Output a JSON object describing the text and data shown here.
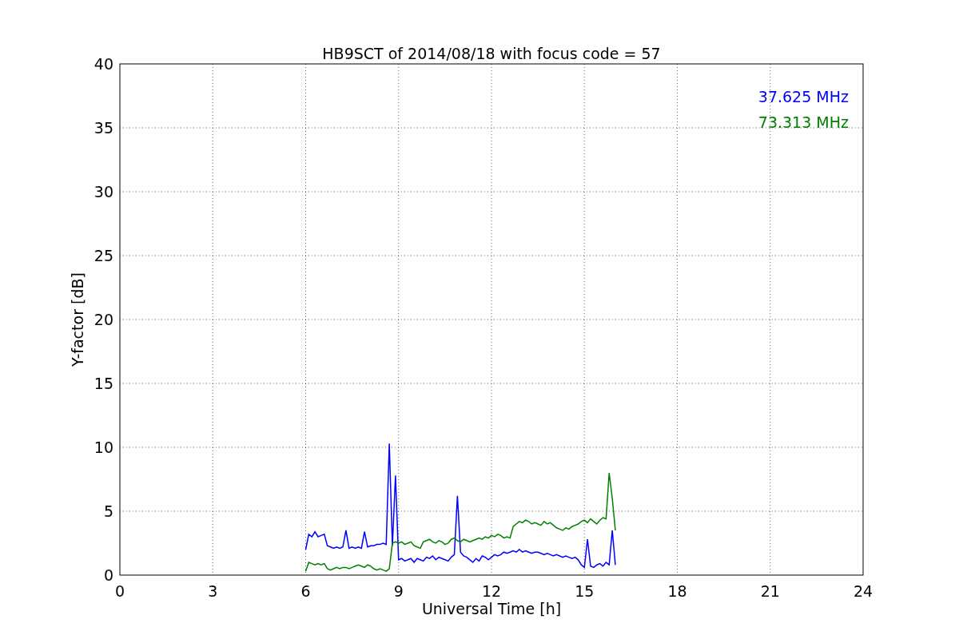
{
  "figure": {
    "chart_data": {
      "type": "line",
      "title": "HB9SCT of 2014/08/18 with focus code = 57",
      "xlabel": "Universal Time [h]",
      "ylabel": "Y-factor [dB]",
      "xlim": [
        0,
        24
      ],
      "ylim": [
        0,
        40
      ],
      "xticks": [
        0,
        3,
        6,
        9,
        12,
        15,
        18,
        21,
        24
      ],
      "yticks": [
        0,
        5,
        10,
        15,
        20,
        25,
        30,
        35,
        40
      ],
      "grid": true,
      "x": [
        6,
        6.1,
        6.2,
        6.3,
        6.4,
        6.5,
        6.6,
        6.7,
        6.8,
        6.9,
        7,
        7.1,
        7.2,
        7.3,
        7.4,
        7.5,
        7.6,
        7.7,
        7.8,
        7.9,
        8,
        8.1,
        8.2,
        8.3,
        8.4,
        8.5,
        8.6,
        8.7,
        8.8,
        8.9,
        9,
        9.1,
        9.2,
        9.3,
        9.4,
        9.5,
        9.6,
        9.7,
        9.8,
        9.9,
        10,
        10.1,
        10.2,
        10.3,
        10.4,
        10.5,
        10.6,
        10.7,
        10.8,
        10.9,
        11,
        11.1,
        11.2,
        11.3,
        11.4,
        11.5,
        11.6,
        11.7,
        11.8,
        11.9,
        12,
        12.1,
        12.2,
        12.3,
        12.4,
        12.5,
        12.6,
        12.7,
        12.8,
        12.9,
        13,
        13.1,
        13.2,
        13.3,
        13.4,
        13.5,
        13.6,
        13.7,
        13.8,
        13.9,
        14,
        14.1,
        14.2,
        14.3,
        14.4,
        14.5,
        14.6,
        14.7,
        14.8,
        14.9,
        15,
        15.1,
        15.2,
        15.3,
        15.4,
        15.5,
        15.6,
        15.7,
        15.8,
        15.9,
        16
      ],
      "series": [
        {
          "name": "37.625 MHz",
          "color": "#0000ff",
          "values": [
            2.0,
            3.2,
            3.0,
            3.4,
            3.0,
            3.1,
            3.2,
            2.3,
            2.2,
            2.1,
            2.2,
            2.1,
            2.2,
            3.5,
            2.1,
            2.2,
            2.1,
            2.2,
            2.1,
            3.4,
            2.2,
            2.3,
            2.3,
            2.4,
            2.4,
            2.5,
            2.4,
            10.3,
            2.3,
            7.8,
            1.2,
            1.3,
            1.1,
            1.2,
            1.3,
            1.0,
            1.3,
            1.2,
            1.1,
            1.4,
            1.3,
            1.5,
            1.2,
            1.4,
            1.3,
            1.2,
            1.1,
            1.4,
            1.6,
            6.2,
            1.8,
            1.5,
            1.4,
            1.2,
            1.0,
            1.3,
            1.1,
            1.5,
            1.4,
            1.2,
            1.4,
            1.6,
            1.5,
            1.6,
            1.8,
            1.7,
            1.8,
            1.9,
            1.8,
            2.0,
            1.8,
            1.9,
            1.8,
            1.7,
            1.8,
            1.8,
            1.7,
            1.6,
            1.7,
            1.6,
            1.5,
            1.6,
            1.5,
            1.4,
            1.5,
            1.4,
            1.3,
            1.4,
            1.2,
            0.8,
            0.6,
            2.8,
            0.7,
            0.6,
            0.8,
            0.9,
            0.7,
            1.0,
            0.8,
            3.5,
            0.8
          ]
        },
        {
          "name": "73.313 MHz",
          "color": "#008000",
          "values": [
            0.3,
            1.0,
            0.9,
            0.8,
            0.9,
            0.8,
            0.9,
            0.5,
            0.4,
            0.5,
            0.6,
            0.5,
            0.6,
            0.6,
            0.5,
            0.6,
            0.7,
            0.8,
            0.7,
            0.6,
            0.8,
            0.7,
            0.5,
            0.4,
            0.5,
            0.4,
            0.3,
            0.5,
            2.5,
            2.6,
            2.5,
            2.6,
            2.4,
            2.5,
            2.6,
            2.3,
            2.2,
            2.1,
            2.6,
            2.7,
            2.8,
            2.6,
            2.5,
            2.7,
            2.6,
            2.4,
            2.5,
            2.8,
            2.9,
            2.7,
            2.6,
            2.8,
            2.7,
            2.6,
            2.7,
            2.8,
            2.9,
            2.8,
            3.0,
            2.9,
            3.1,
            3.0,
            3.2,
            3.1,
            2.9,
            3.0,
            2.9,
            3.8,
            4.0,
            4.2,
            4.1,
            4.3,
            4.2,
            4.0,
            4.1,
            4.0,
            3.9,
            4.2,
            4.0,
            4.1,
            3.9,
            3.7,
            3.6,
            3.5,
            3.7,
            3.6,
            3.8,
            3.9,
            4.0,
            4.2,
            4.3,
            4.1,
            4.4,
            4.2,
            4.0,
            4.3,
            4.5,
            4.4,
            8.0,
            6.0,
            3.5
          ]
        }
      ]
    }
  }
}
